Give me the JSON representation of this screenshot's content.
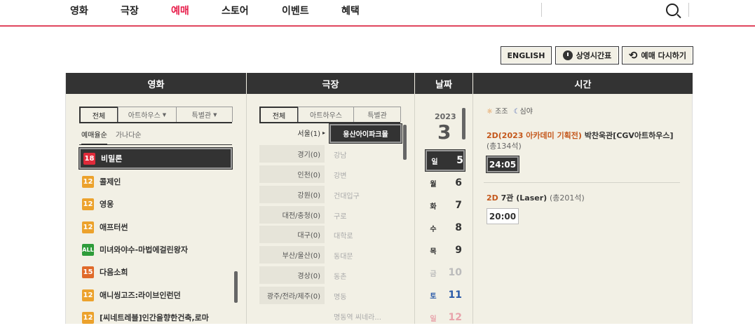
{
  "nav": {
    "items": [
      "영화",
      "극장",
      "예매",
      "스토어",
      "이벤트",
      "혜택"
    ]
  },
  "toolbar": {
    "english": "ENGLISH",
    "schedule": "상영시간표",
    "rebook": "예매 다시하기"
  },
  "columns": {
    "movie": "영화",
    "theater": "극장",
    "date": "날짜",
    "time": "시간"
  },
  "movie_tabs": [
    "전체",
    "아트하우스",
    "특별관"
  ],
  "movie_sort": [
    "예매율순",
    "가나다순"
  ],
  "movies": [
    {
      "rating": "18",
      "title": "비밀론"
    },
    {
      "rating": "12",
      "title": "콜제인"
    },
    {
      "rating": "12",
      "title": "영웅"
    },
    {
      "rating": "12",
      "title": "애프터썬"
    },
    {
      "rating": "ALL",
      "title": "미녀와야수-마법에걸린왕자"
    },
    {
      "rating": "15",
      "title": "다음소희"
    },
    {
      "rating": "12",
      "title": "애니씽고즈:라이브인런던"
    },
    {
      "rating": "12",
      "title": "[씨네트레블]인간을향한건축,로마"
    }
  ],
  "theater_tabs": [
    "전체",
    "아트하우스",
    "특별관"
  ],
  "regions": [
    "서울(1)",
    "경기(0)",
    "인천(0)",
    "강원(0)",
    "대전/충청(0)",
    "대구(0)",
    "부산/울산(0)",
    "경상(0)",
    "광주/전라/제주(0)"
  ],
  "theaters": [
    "용산아이파크몰",
    "강남",
    "강변",
    "건대입구",
    "구로",
    "대학로",
    "동대문",
    "동촌",
    "명동",
    "명동역 씨네라..."
  ],
  "date": {
    "year": "2023",
    "month": "3",
    "days": [
      {
        "dow": "일",
        "num": "5"
      },
      {
        "dow": "월",
        "num": "6"
      },
      {
        "dow": "화",
        "num": "7"
      },
      {
        "dow": "수",
        "num": "8"
      },
      {
        "dow": "목",
        "num": "9"
      },
      {
        "dow": "금",
        "num": "10"
      },
      {
        "dow": "토",
        "num": "11"
      },
      {
        "dow": "일",
        "num": "12"
      }
    ]
  },
  "time": {
    "filter_morning": "조조",
    "filter_night": "심야",
    "screens": [
      {
        "tag": "2D(2023 아카데미 기획전)",
        "name": "박찬욱관[CGV아트하우스]",
        "seats": "(총134석)",
        "times": [
          "24:05"
        ]
      },
      {
        "tag": "2D",
        "name": "7관 (Laser)",
        "seats": "(총201석)",
        "times": [
          "20:00"
        ]
      }
    ]
  },
  "colors": {
    "accent": "#e71a48",
    "header": "#333333",
    "panel": "#f2f0e5"
  }
}
